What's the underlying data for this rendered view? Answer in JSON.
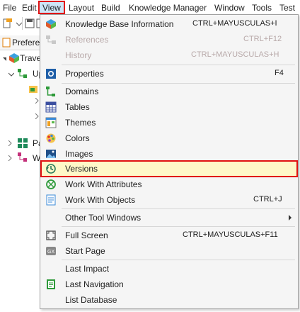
{
  "menubar": {
    "items": [
      "File",
      "Edit",
      "View",
      "Layout",
      "Build",
      "Knowledge Manager",
      "Window",
      "Tools",
      "Test"
    ]
  },
  "background": {
    "tab_label": "Prefere",
    "tree": [
      "Trave",
      "Up",
      "Pa",
      "W"
    ]
  },
  "view_menu": {
    "items": [
      {
        "label": "Knowledge Base Information",
        "shortcut": "CTRL+MAYUSCULAS+I",
        "icon": "kb-info-icon"
      },
      {
        "label": "References",
        "shortcut": "CTRL+F12",
        "icon": "references-icon",
        "disabled": true
      },
      {
        "label": "History",
        "shortcut": "CTRL+MAYUSCULAS+H",
        "disabled": true
      },
      {
        "label": "Properties",
        "shortcut": "F4",
        "icon": "properties-icon"
      },
      {
        "label": "Domains",
        "icon": "domains-icon"
      },
      {
        "label": "Tables",
        "icon": "tables-icon"
      },
      {
        "label": "Themes",
        "icon": "themes-icon"
      },
      {
        "label": "Colors",
        "icon": "colors-icon"
      },
      {
        "label": "Images",
        "icon": "images-icon"
      },
      {
        "label": "Versions",
        "icon": "versions-icon",
        "highlighted": true
      },
      {
        "label": "Work With Attributes",
        "icon": "work-with-attributes-icon"
      },
      {
        "label": "Work With Objects",
        "shortcut": "CTRL+J",
        "icon": "work-with-objects-icon"
      },
      {
        "label": "Other Tool Windows",
        "submenu": true
      },
      {
        "label": "Full Screen",
        "shortcut": "CTRL+MAYUSCULAS+F11",
        "icon": "full-screen-icon"
      },
      {
        "label": "Start Page",
        "icon": "start-page-icon"
      },
      {
        "label": "Last Impact"
      },
      {
        "label": "Last Navigation",
        "icon": "last-navigation-icon"
      },
      {
        "label": "List Database"
      }
    ]
  },
  "colors": {
    "highlight_border": "#e11212",
    "highlight_fill": "#fff8c8",
    "disabled_text": "#b8a9a9"
  }
}
